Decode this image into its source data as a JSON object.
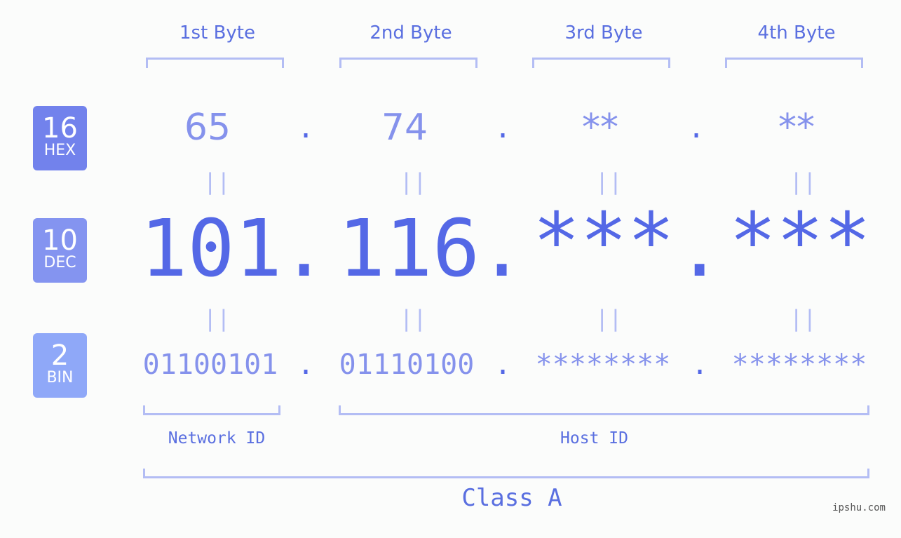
{
  "bases": [
    {
      "number": "16",
      "label": "HEX",
      "color": "#7282ec"
    },
    {
      "number": "10",
      "label": "DEC",
      "color": "#8494f0"
    },
    {
      "number": "2",
      "label": "BIN",
      "color": "#8fa8f8"
    }
  ],
  "byte_headers": [
    "1st Byte",
    "2nd Byte",
    "3rd Byte",
    "4th Byte"
  ],
  "hex": [
    "65",
    "74",
    "**",
    "**"
  ],
  "dec": [
    "101",
    "116",
    "***",
    "***"
  ],
  "bin": [
    "01100101",
    "01110100",
    "********",
    "********"
  ],
  "separator": ".",
  "equals": "||",
  "network_id_label": "Network ID",
  "host_id_label": "Host ID",
  "class_label": "Class A",
  "watermark": "ipshu.com"
}
